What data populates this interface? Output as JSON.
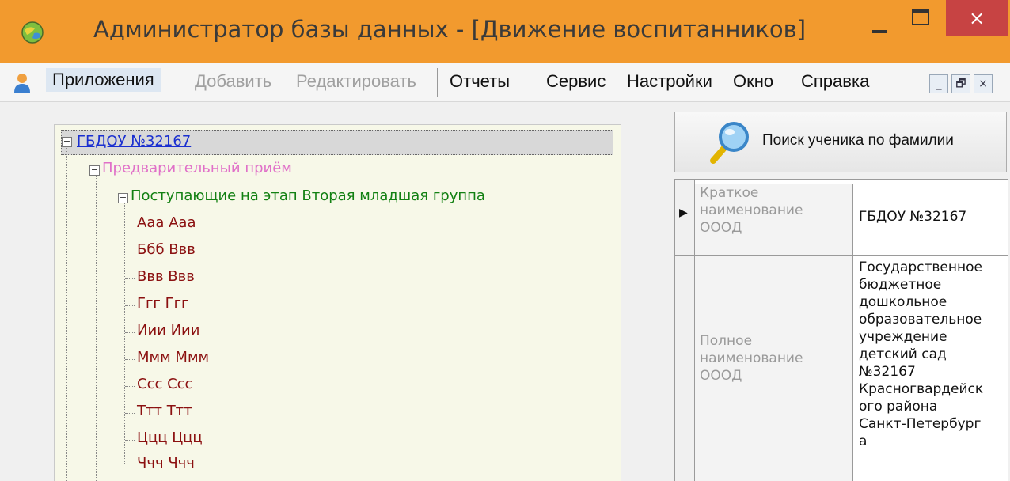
{
  "window": {
    "title": "Администратор базы данных - [Движение воспитанников]",
    "close_glyph": "×",
    "accent_color": "#f29a2e",
    "close_color": "#c74343"
  },
  "menu": {
    "items": [
      "Приложения",
      "Добавить",
      "Редактировать",
      "Отчеты",
      "Сервис",
      "Настройки",
      "Окно",
      "Справка"
    ],
    "mdi_buttons": [
      "_",
      "🗗",
      "×"
    ]
  },
  "tree": {
    "root": "ГБДОУ №32167",
    "level1": "Предварительный приём",
    "level2": "Поступающие на этап Вторая младшая группа",
    "children": [
      "Ааа Ааа",
      "Ббб Ввв",
      "Ввв Ввв",
      "Ггг Ггг",
      "Иии Иии",
      "Ммм Ммм",
      "Ссс Ссс",
      "Ттт Ттт",
      "Ццц Ццц",
      "Ччч Ччч"
    ],
    "expander_glyph": "−",
    "colors": {
      "root": "#1a2fd0",
      "level1": "#e070c8",
      "level2": "#128012",
      "child": "#8b1010"
    }
  },
  "search": {
    "label": "Поиск ученика по фамилии"
  },
  "grid": {
    "selected_marker": "▶",
    "rows": [
      {
        "label": "Краткое наименование ОООД",
        "value": "ГБДОУ №32167"
      },
      {
        "label": "Полное наименование ОООД",
        "value": "Государственное бюджетное дошкольное образовательное учреждение детский сад №32167 Красногвардейского района Санкт-Петербурга"
      }
    ],
    "row1_label_lines": [
      "Краткое",
      "наименование",
      "ОООД"
    ],
    "row2_label_lines": [
      "Полное",
      "наименование",
      "ОООД"
    ],
    "row2_value_lines": [
      "Государственное",
      "бюджетное",
      "дошкольное",
      "образовательное",
      "учреждение",
      "детский сад",
      "№32167",
      "Красногвардейск",
      "ого района",
      "Санкт-Петербург",
      "а"
    ]
  }
}
